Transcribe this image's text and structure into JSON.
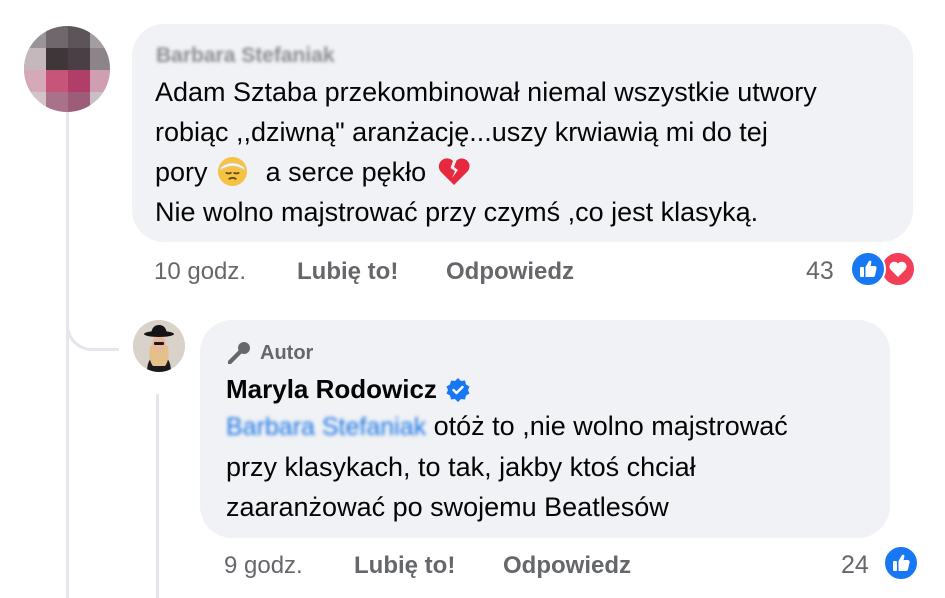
{
  "comment": {
    "author_name": "Barbara Stefaniak",
    "text_line1": "Adam Sztaba przekombinował niemal wszystkie utwory",
    "text_line2": "robiąc ,,dziwną\" aranżację...uszy krwiawią mi do tej",
    "text_line3a": "pory",
    "text_line3b": "a serce pękło",
    "text_line4": "Nie wolno majstrować przy czymś ,co jest  klasyką.",
    "time": "10 godz.",
    "like_label": "Lubię to!",
    "reply_label": "Odpowiedz",
    "reaction_count": "43",
    "reactions": [
      "like-icon",
      "love-icon"
    ],
    "emoji_1": "pensive-face-with-bandage-icon",
    "emoji_2": "broken-heart-icon"
  },
  "reply": {
    "badge_label": "Autor",
    "author_name": "Maryla Rodowicz",
    "verified": true,
    "mention": "Barbara Stefaniak",
    "text_line1": "otóż to ,nie wolno majstrować",
    "text_line2": "przy klasykach, to tak, jakby ktoś chciał",
    "text_line3": "zaaranżować po swojemu Beatlesów",
    "time": "9 godz.",
    "like_label": "Lubię to!",
    "reply_label": "Odpowiedz",
    "reaction_count": "24",
    "reactions": [
      "like-icon"
    ]
  },
  "colors": {
    "bubble": "#f0f2f5",
    "meta_text": "#65676b",
    "like_blue": "#1877f2",
    "love_red": "#f33e58",
    "mention_blue": "#1b74e4"
  }
}
